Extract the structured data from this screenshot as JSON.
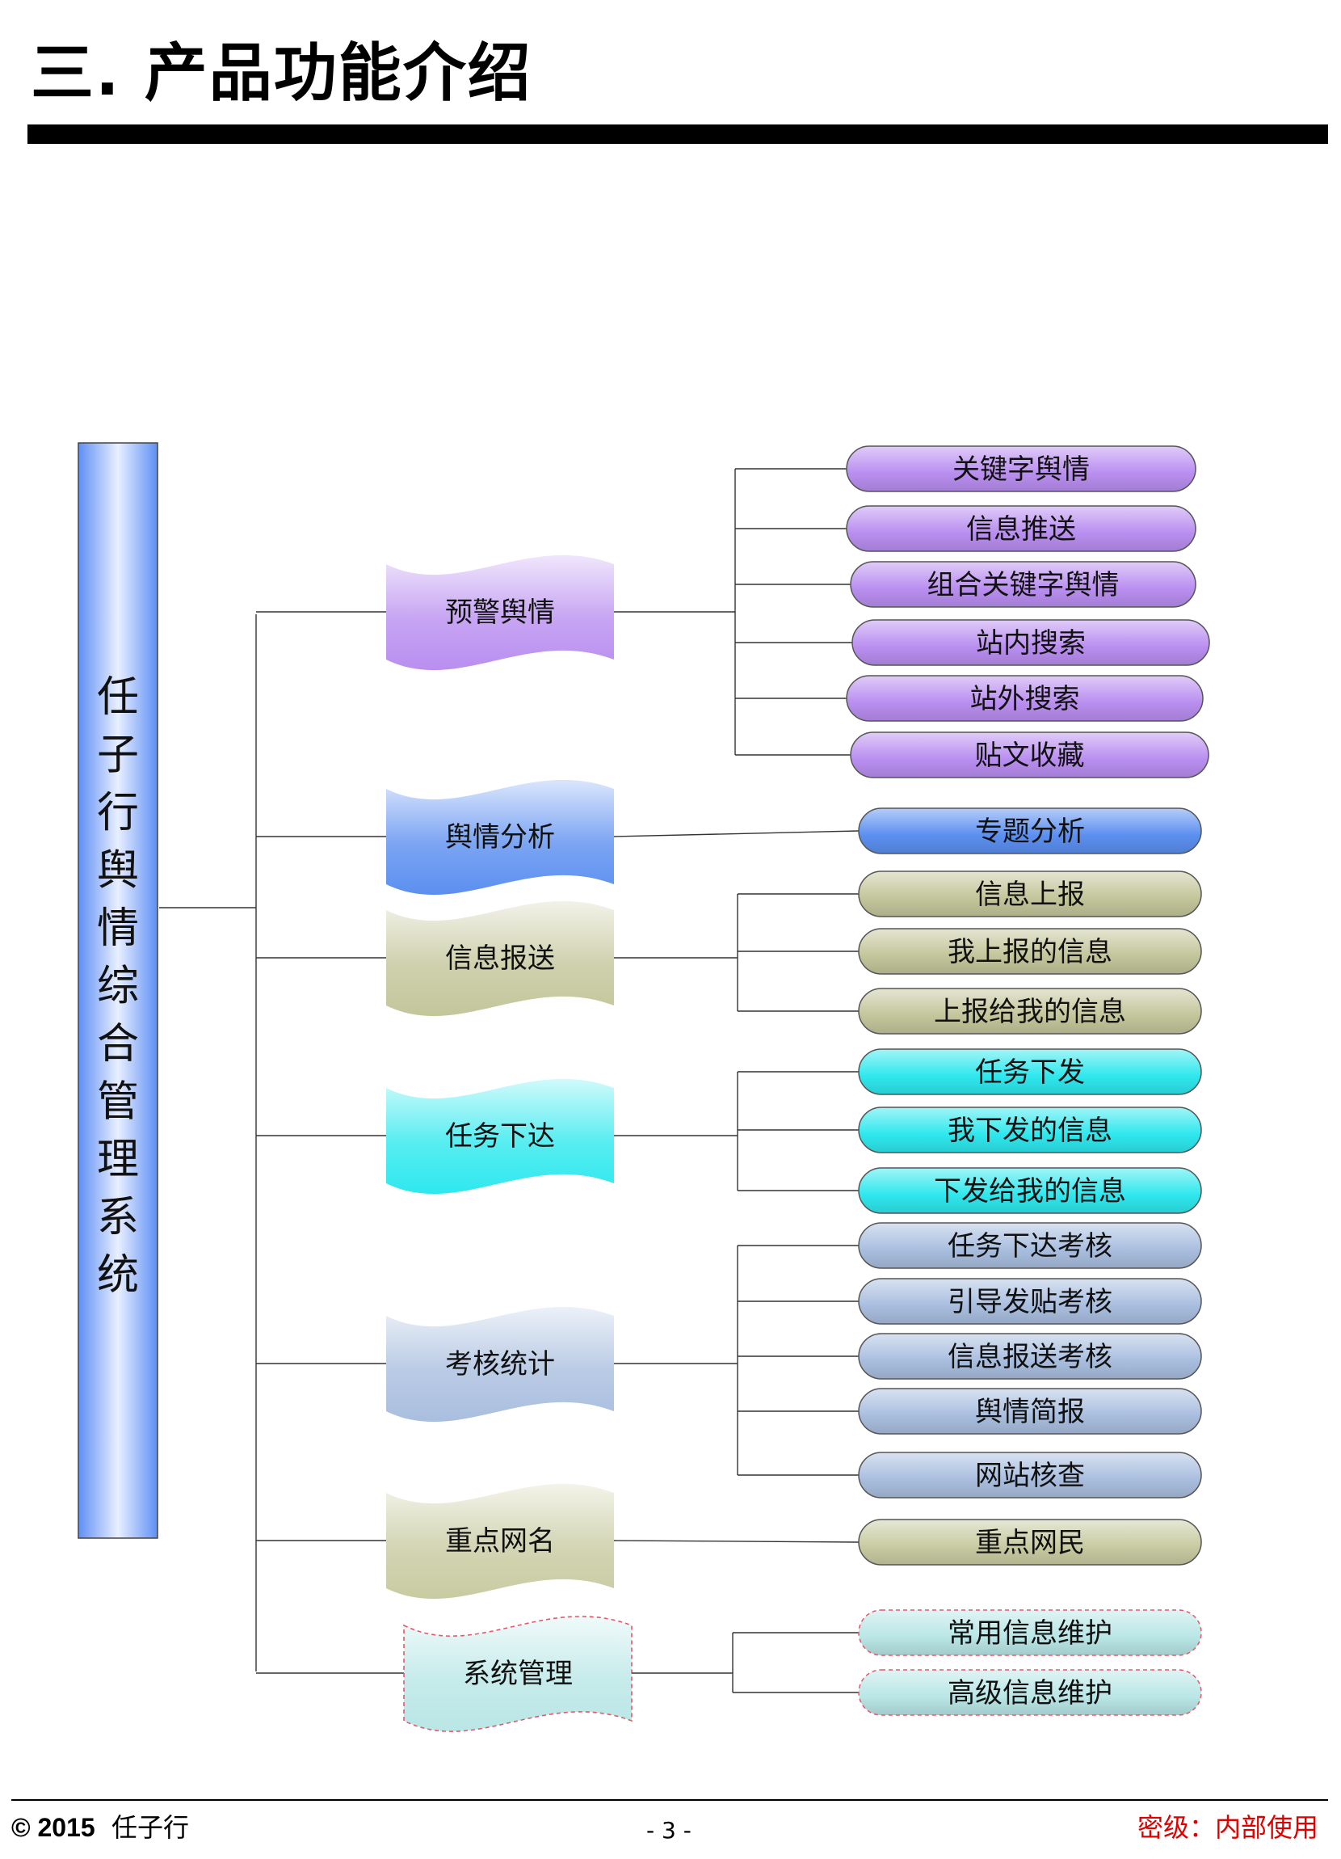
{
  "title": "三.  产品功能介绍",
  "root": "任子行舆情综合管理系统",
  "groups": [
    {
      "label": "预警舆情",
      "color": "#b98ef0",
      "items": [
        "关键字舆情",
        "信息推送",
        "组合关键字舆情",
        "站内搜索",
        "站外搜索",
        "贴文收藏"
      ]
    },
    {
      "label": "舆情分析",
      "color": "#5b8ff0",
      "items": [
        "专题分析"
      ]
    },
    {
      "label": "信息报送",
      "color": "#c3c69a",
      "items": [
        "信息上报",
        "我上报的信息",
        "上报给我的信息"
      ]
    },
    {
      "label": "任务下达",
      "color": "#2ee8ee",
      "items": [
        "任务下发",
        "我下发的信息",
        "下发给我的信息"
      ]
    },
    {
      "label": "考核统计",
      "color": "#a9bedf",
      "items": [
        "任务下达考核",
        "引导发贴考核",
        "信息报送考核",
        "舆情简报",
        "网站核查"
      ]
    },
    {
      "label": "重点网名",
      "color": "#c8cba1",
      "items": [
        "重点网民"
      ]
    },
    {
      "label": "系统管理",
      "color": "#b9e6e6",
      "items": [
        "常用信息维护",
        "高级信息维护"
      ]
    }
  ],
  "footer": {
    "copyright": "© 2015",
    "company": "任子行",
    "page": "- 3 -",
    "classification": "密级：内部使用"
  }
}
